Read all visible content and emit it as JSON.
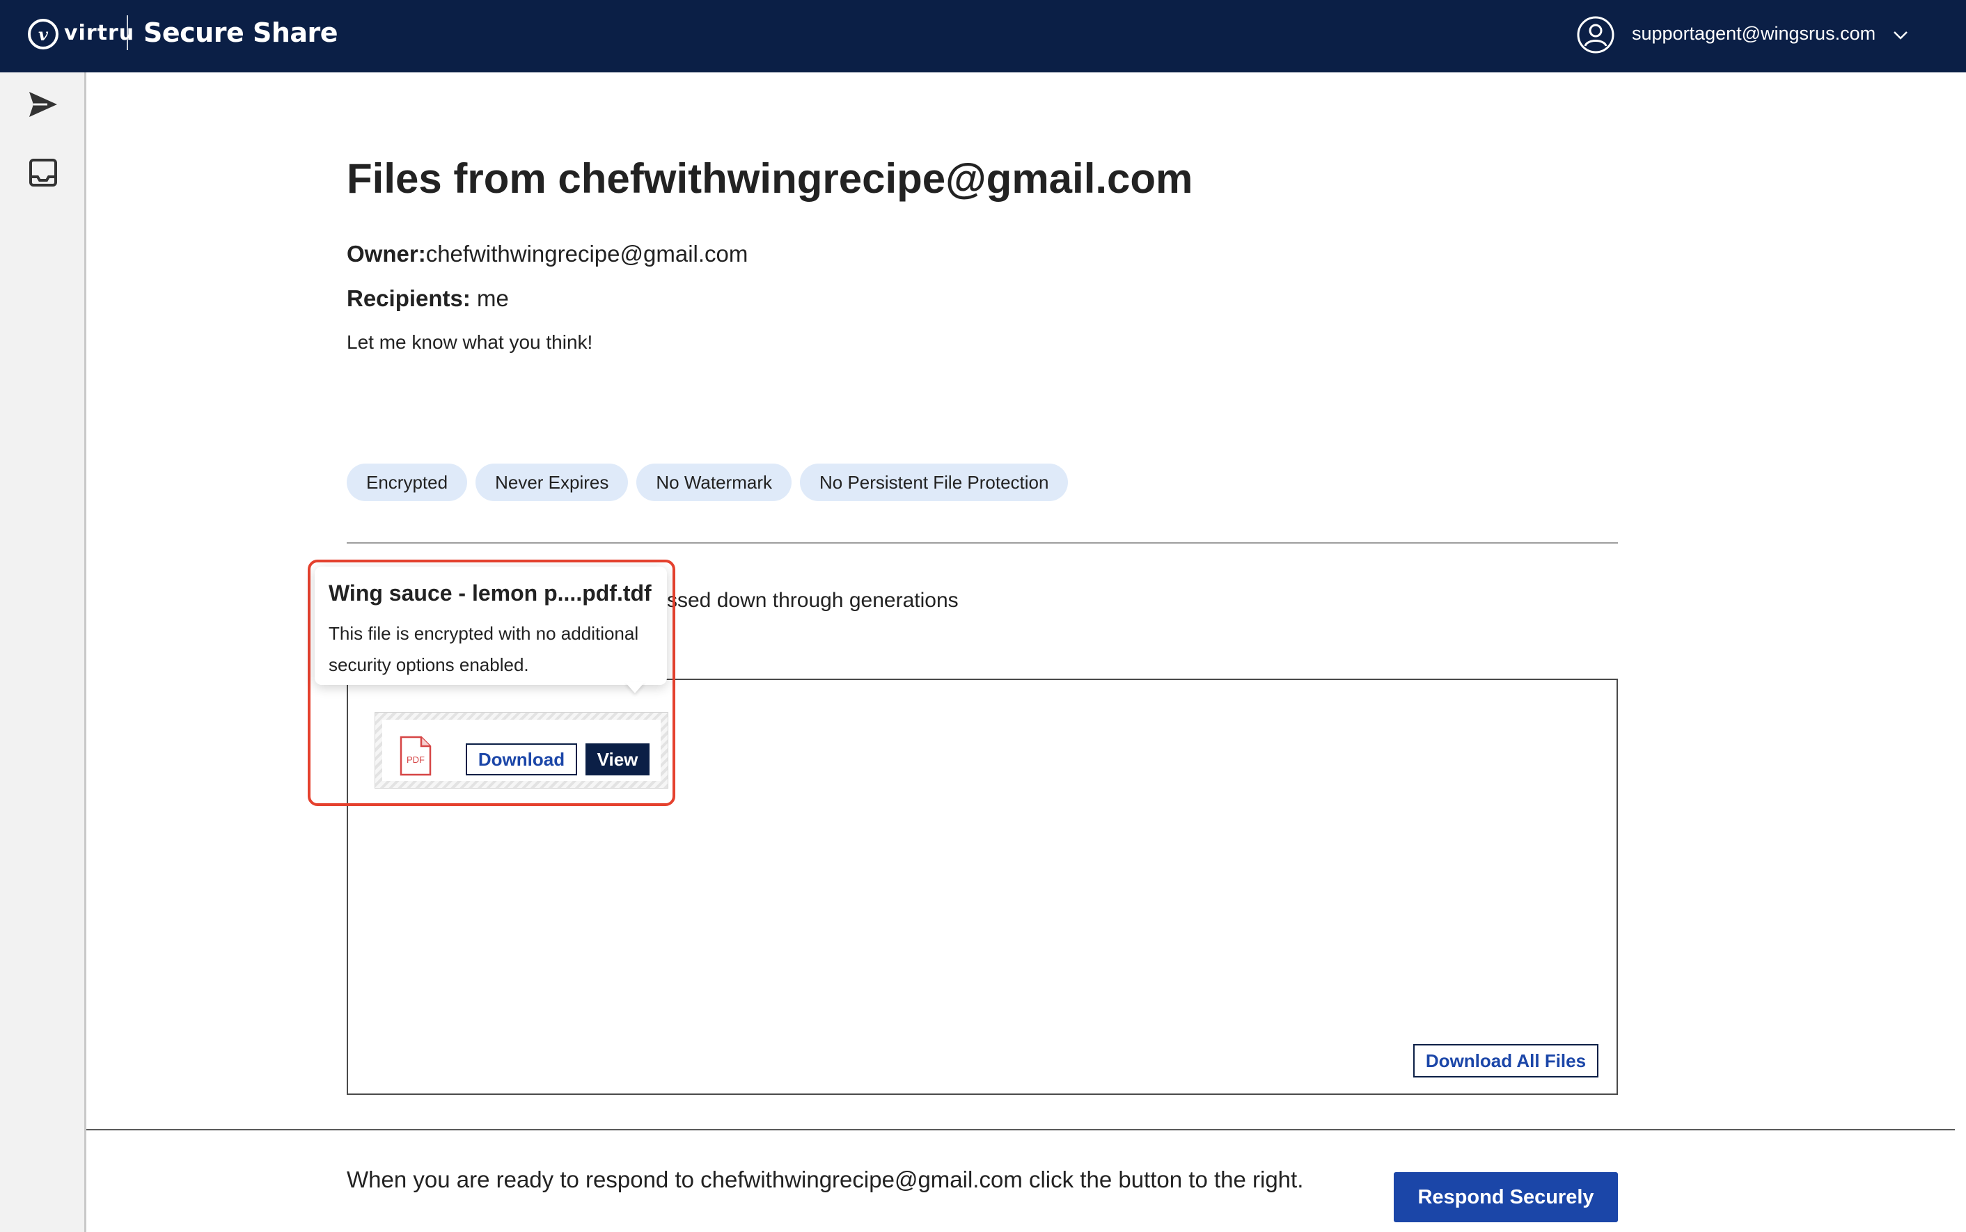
{
  "header": {
    "logo_mark": "v",
    "logo_text": "virtru",
    "app_title": "Secure Share",
    "user_email": "supportagent@wingsrus.com"
  },
  "sidebar": {
    "items": [
      {
        "icon": "send-icon"
      },
      {
        "icon": "inbox-icon"
      }
    ]
  },
  "main": {
    "title": "Files from chefwithwingrecipe@gmail.com",
    "owner_label": "Owner:",
    "owner_value": "chefwithwingrecipe@gmail.com",
    "recipients_label": "Recipients:",
    "recipients_value": " me",
    "message": "Let me know what you think!",
    "badges": [
      "Encrypted",
      "Never Expires",
      "No Watermark",
      "No Persistent File Protection"
    ],
    "description_visible": "ssed down through generations",
    "download_all_label": "Download All Files"
  },
  "file": {
    "type_label": "PDF",
    "download_label": "Download",
    "view_label": "View"
  },
  "tooltip": {
    "title": "Wing sauce - lemon p....pdf.tdf",
    "body": "This file is encrypted with no additional security options enabled."
  },
  "footer": {
    "text": "When you are ready to respond to chefwithwingrecipe@gmail.com click the button to the right.",
    "respond_label": "Respond Securely"
  },
  "colors": {
    "topbar": "#0b1f46",
    "accent": "#1b46a8",
    "badge_bg": "#dfeaf9",
    "highlight": "#e5412e"
  }
}
